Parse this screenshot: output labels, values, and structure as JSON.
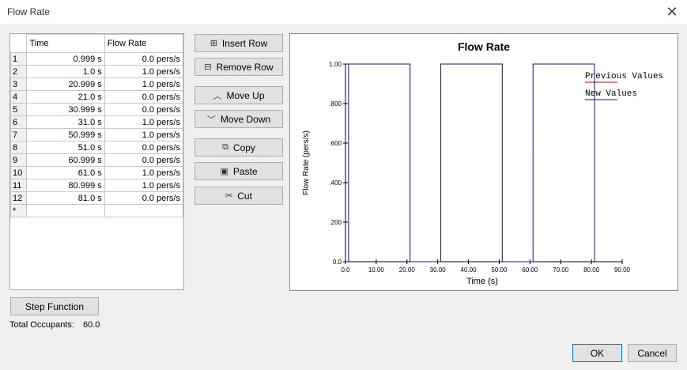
{
  "window": {
    "title": "Flow Rate",
    "close_icon": "close-icon"
  },
  "table": {
    "headers": [
      "Time",
      "Flow Rate"
    ],
    "rows": [
      {
        "n": "1",
        "time": "0.999 s",
        "rate": "0.0 pers/s"
      },
      {
        "n": "2",
        "time": "1.0 s",
        "rate": "1.0 pers/s"
      },
      {
        "n": "3",
        "time": "20.999 s",
        "rate": "1.0 pers/s"
      },
      {
        "n": "4",
        "time": "21.0 s",
        "rate": "0.0 pers/s"
      },
      {
        "n": "5",
        "time": "30.999 s",
        "rate": "0.0 pers/s"
      },
      {
        "n": "6",
        "time": "31.0 s",
        "rate": "1.0 pers/s"
      },
      {
        "n": "7",
        "time": "50.999 s",
        "rate": "1.0 pers/s"
      },
      {
        "n": "8",
        "time": "51.0 s",
        "rate": "0.0 pers/s"
      },
      {
        "n": "9",
        "time": "60.999 s",
        "rate": "0.0 pers/s"
      },
      {
        "n": "10",
        "time": "61.0 s",
        "rate": "1.0 pers/s"
      },
      {
        "n": "11",
        "time": "80.999 s",
        "rate": "1.0 pers/s"
      },
      {
        "n": "12",
        "time": "81.0 s",
        "rate": "0.0 pers/s"
      }
    ],
    "new_row_marker": "*"
  },
  "buttons": {
    "insert_row": "Insert Row",
    "remove_row": "Remove Row",
    "move_up": "Move Up",
    "move_down": "Move Down",
    "copy": "Copy",
    "paste": "Paste",
    "cut": "Cut",
    "step_function": "Step Function",
    "ok": "OK",
    "cancel": "Cancel"
  },
  "footer": {
    "total_label": "Total Occupants:",
    "total_value": "60.0"
  },
  "chart_data": {
    "type": "line",
    "title": "Flow Rate",
    "xlabel": "Time (s)",
    "ylabel": "Flow Rate (pers/s)",
    "xlim": [
      0,
      90
    ],
    "ylim": [
      0,
      1
    ],
    "xticks": [
      "0.0",
      "10.00",
      "20.00",
      "30.00",
      "40.00",
      "50.00",
      "60.00",
      "70.00",
      "80.00",
      "90.00"
    ],
    "yticks": [
      "0.0",
      ".200",
      ".400",
      ".600",
      ".800",
      "1.00"
    ],
    "legend_position": "top-right",
    "series": [
      {
        "name": "Previous Values",
        "color": "#d00000",
        "x": [],
        "y": []
      },
      {
        "name": "New Values",
        "color": "#1010a0",
        "x": [
          0,
          0.999,
          1.0,
          20.999,
          21.0,
          30.999,
          31.0,
          50.999,
          51.0,
          60.999,
          61.0,
          80.999,
          81.0
        ],
        "y": [
          0,
          0,
          1,
          1,
          0,
          0,
          1,
          1,
          0,
          0,
          1,
          1,
          0
        ]
      }
    ]
  }
}
